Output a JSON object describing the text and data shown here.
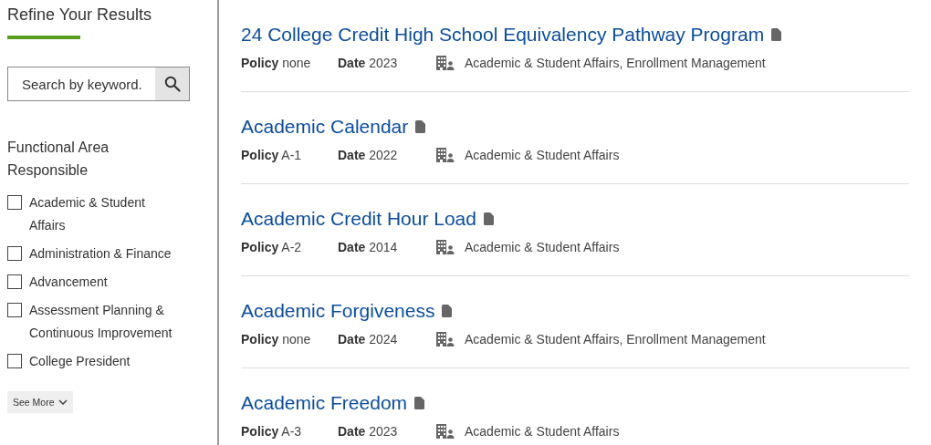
{
  "sidebar": {
    "heading": "Refine Your Results",
    "search": {
      "placeholder": "Search by keyword."
    },
    "filter_group": {
      "title": "Functional Area Responsible",
      "options": [
        {
          "label": "Academic & Student Affairs",
          "checked": false
        },
        {
          "label": "Administration & Finance",
          "checked": false
        },
        {
          "label": "Advancement",
          "checked": false
        },
        {
          "label": "Assessment Planning & Continuous Improvement",
          "checked": false
        },
        {
          "label": "College President",
          "checked": false
        }
      ],
      "more_button": "See More"
    }
  },
  "results": [
    {
      "title": "24 College Credit High School Equivalency Pathway Program",
      "policy_label": "Policy",
      "policy": "none",
      "date_label": "Date",
      "date": "2023",
      "areas": "Academic & Student Affairs, Enrollment Management"
    },
    {
      "title": "Academic Calendar",
      "policy_label": "Policy",
      "policy": "A-1",
      "date_label": "Date",
      "date": "2022",
      "areas": "Academic & Student Affairs"
    },
    {
      "title": "Academic Credit Hour Load",
      "policy_label": "Policy",
      "policy": "A-2",
      "date_label": "Date",
      "date": "2014",
      "areas": "Academic & Student Affairs"
    },
    {
      "title": "Academic Forgiveness",
      "policy_label": "Policy",
      "policy": "none",
      "date_label": "Date",
      "date": "2024",
      "areas": "Academic & Student Affairs, Enrollment Management"
    },
    {
      "title": "Academic Freedom",
      "policy_label": "Policy",
      "policy": "A-3",
      "date_label": "Date",
      "date": "2023",
      "areas": "Academic & Student Affairs"
    }
  ]
}
